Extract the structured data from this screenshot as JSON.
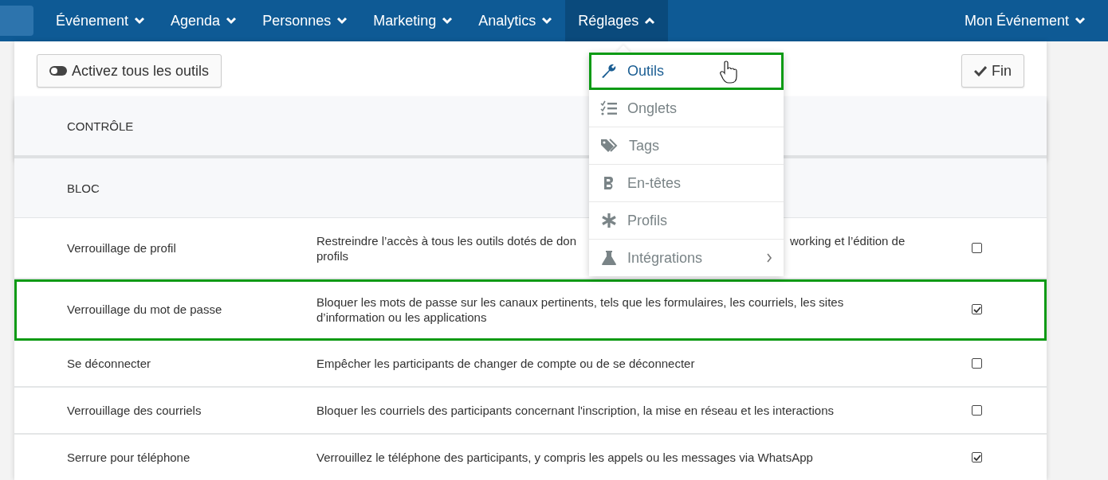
{
  "nav": {
    "items": [
      {
        "label": "Événement",
        "expanded": false
      },
      {
        "label": "Agenda",
        "expanded": false
      },
      {
        "label": "Personnes",
        "expanded": false
      },
      {
        "label": "Marketing",
        "expanded": false
      },
      {
        "label": "Analytics",
        "expanded": false
      },
      {
        "label": "Réglages",
        "expanded": true
      }
    ],
    "event_menu": {
      "label": "Mon Événement",
      "expanded": false
    }
  },
  "toolbar": {
    "toggle_all": "Activez tous les outils",
    "done": "Fin"
  },
  "sections": [
    {
      "title": "CONTRÔLE"
    },
    {
      "title": "BLOC"
    }
  ],
  "rows": [
    {
      "name": "Verrouillage de profil",
      "description_visible": [
        "Restreindre l’accès à tous les outils dotés de don",
        "working et l’édition de",
        "profils"
      ],
      "checked": false,
      "highlighted": false
    },
    {
      "name": "Verrouillage du mot de passe",
      "description_visible": [
        "Bloquer les mots de passe sur les canaux pertinents, tels que les formulaires, les courriels, les sites d’information ou les applications"
      ],
      "checked": true,
      "highlighted": true
    },
    {
      "name": "Se déconnecter",
      "description_visible": [
        "Empêcher les participants de changer de compte ou de se déconnecter"
      ],
      "checked": false,
      "highlighted": false
    },
    {
      "name": "Verrouillage des courriels",
      "description_visible": [
        "Bloquer les courriels des participants concernant l'inscription, la mise en réseau et les interactions"
      ],
      "checked": false,
      "highlighted": false
    },
    {
      "name": "Serrure pour téléphone",
      "description_visible": [
        "Verrouillez le téléphone des participants, y compris les appels ou les messages via WhatsApp"
      ],
      "checked": true,
      "highlighted": false
    }
  ],
  "dropdown": {
    "items": [
      {
        "label": "Outils",
        "selected": true,
        "highlighted": true,
        "has_submenu": false
      },
      {
        "label": "Onglets",
        "selected": false,
        "highlighted": false,
        "has_submenu": false
      },
      {
        "label": "Tags",
        "selected": false,
        "highlighted": false,
        "has_submenu": false
      },
      {
        "label": "En-têtes",
        "selected": false,
        "highlighted": false,
        "has_submenu": false
      },
      {
        "label": "Profils",
        "selected": false,
        "highlighted": false,
        "has_submenu": false
      },
      {
        "label": "Intégrations",
        "selected": false,
        "highlighted": false,
        "has_submenu": true
      }
    ]
  }
}
